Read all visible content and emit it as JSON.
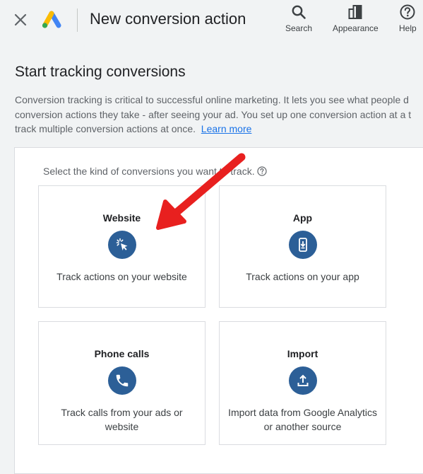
{
  "header": {
    "title": "New conversion action",
    "close_icon": "close-icon",
    "logo": "google-ads-logo",
    "tools": [
      {
        "label": "Search",
        "icon": "search-icon"
      },
      {
        "label": "Appearance",
        "icon": "appearance-icon"
      },
      {
        "label": "Help",
        "icon": "help-icon"
      }
    ]
  },
  "main": {
    "section_title": "Start tracking conversions",
    "intro_lines": [
      "Conversion tracking is critical to successful online marketing. It lets you see what people d",
      "conversion actions they take - after seeing your ad. You set up one conversion action at a t",
      "track multiple conversion actions at once."
    ],
    "learn_more": "Learn more",
    "prompt": "Select the kind of conversions you want to track.",
    "cards": [
      {
        "title": "Website",
        "icon": "cursor-click-icon",
        "desc": "Track actions on your website"
      },
      {
        "title": "App",
        "icon": "mobile-download-icon",
        "desc": "Track actions on your app"
      },
      {
        "title": "Phone calls",
        "icon": "phone-icon",
        "desc": "Track calls from your ads or website"
      },
      {
        "title": "Import",
        "icon": "upload-icon",
        "desc": "Import data from Google Analytics or another source"
      }
    ]
  },
  "colors": {
    "accent_blue": "#1a73e8",
    "icon_circle": "#2c5f97",
    "annotation_arrow": "#e8201f",
    "page_background": "#f1f3f4"
  },
  "annotation": {
    "arrow_icon": "red-arrow-pointing-to-website-card"
  }
}
